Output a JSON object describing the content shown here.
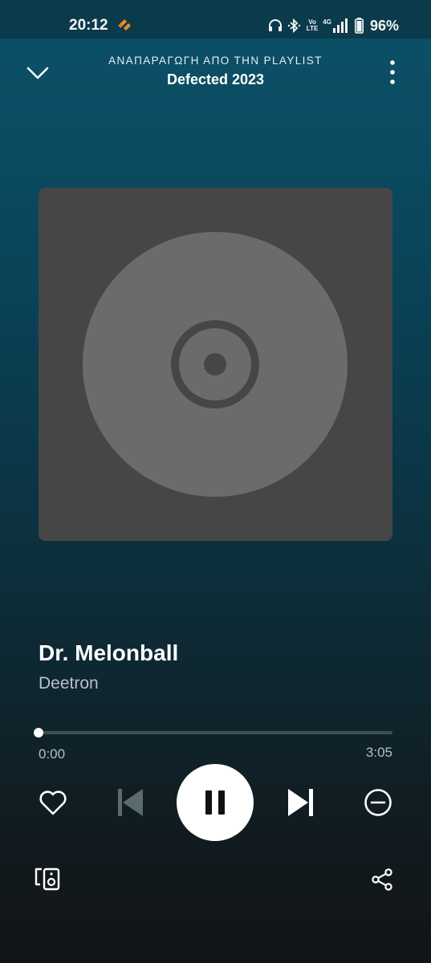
{
  "status_bar": {
    "time": "20:12",
    "app_icon": "soundcloud-like-icon",
    "icons": [
      "headphones-icon",
      "bluetooth-icon",
      "volte-icon",
      "signal-4g-icon",
      "battery-icon"
    ],
    "volte_line1": "Vo",
    "volte_line2": "LTE",
    "network": "4G",
    "battery": "96%"
  },
  "header": {
    "caption": "ΑΝΑΠΑΡΑΓΩΓΗ ΑΠΟ ΤΗΝ PLAYLIST",
    "title": "Defected 2023",
    "collapse_icon": "chevron-down-icon",
    "menu_icon": "more-vertical-icon"
  },
  "cover": {
    "placeholder_icon": "disc-icon",
    "background_color": "#464646"
  },
  "track": {
    "title": "Dr. Melonball",
    "artist": "Deetron"
  },
  "progress": {
    "elapsed": "0:00",
    "total": "3:05",
    "fraction": 0.0
  },
  "controls": {
    "like_icon": "heart-outline-icon",
    "prev_icon": "skip-previous-icon",
    "play_state_icon": "pause-icon",
    "next_icon": "skip-next-icon",
    "hide_icon": "minus-circle-icon",
    "devices_icon": "connect-devices-icon",
    "share_icon": "share-icon"
  },
  "colors": {
    "accent": "#ffffff",
    "background_top": "#0b5068",
    "background_bottom": "#121416"
  }
}
